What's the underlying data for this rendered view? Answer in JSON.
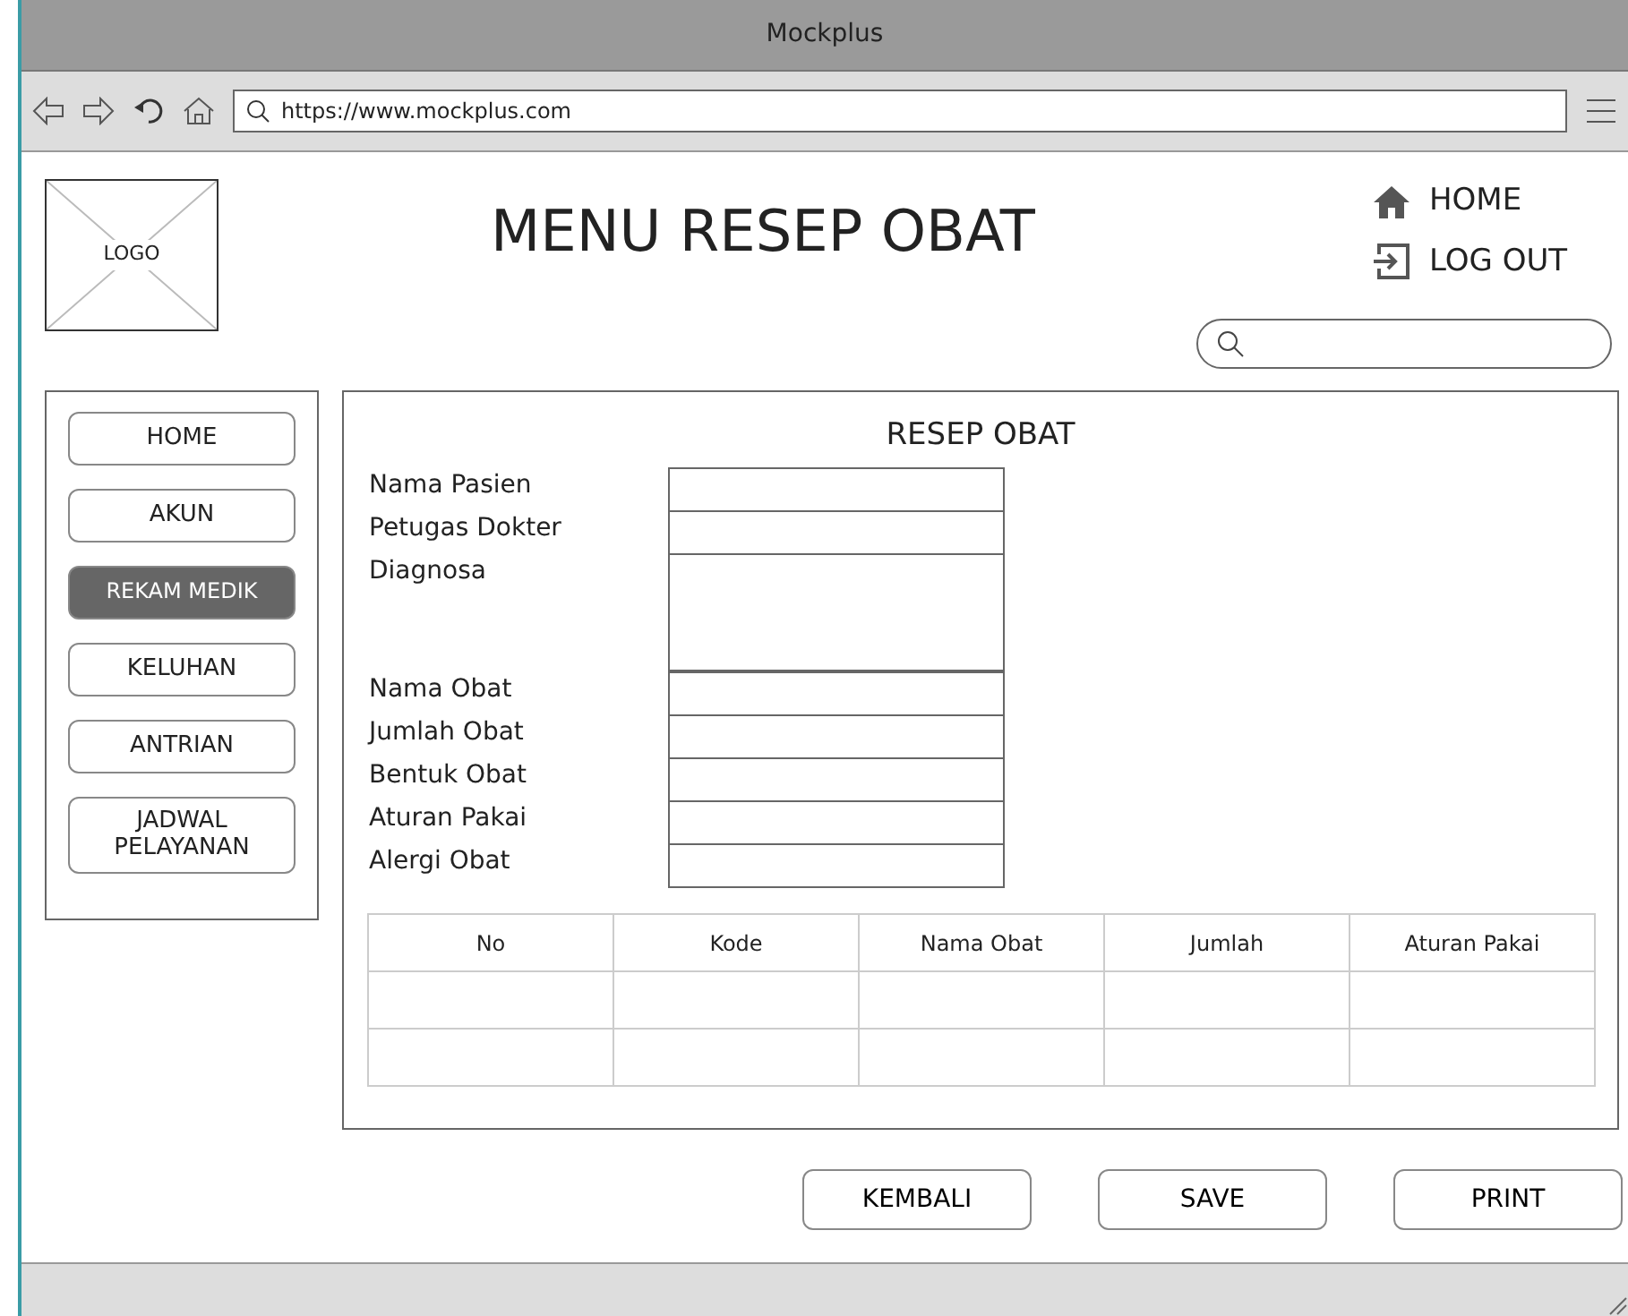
{
  "window": {
    "title": "Mockplus"
  },
  "address_bar": {
    "url": "https://www.mockplus.com"
  },
  "header": {
    "logo": "LOGO",
    "title": "MENU RESEP OBAT",
    "links": [
      {
        "kind": "home",
        "label": "HOME"
      },
      {
        "kind": "logout",
        "label": "LOG OUT"
      }
    ]
  },
  "sidebar": {
    "items": [
      {
        "label": "HOME",
        "selected": false
      },
      {
        "label": "AKUN",
        "selected": false
      },
      {
        "label": "REKAM MEDIK",
        "selected": true
      },
      {
        "label": "KELUHAN",
        "selected": false
      },
      {
        "label": "ANTRIAN",
        "selected": false
      },
      {
        "label": "JADWAL PELAYANAN",
        "selected": false
      }
    ]
  },
  "form": {
    "title": "RESEP OBAT",
    "fields": [
      {
        "label": "Nama Pasien",
        "kind": "text"
      },
      {
        "label": "Petugas Dokter",
        "kind": "text"
      },
      {
        "label": "Diagnosa",
        "kind": "textarea"
      },
      {
        "label": "Nama Obat",
        "kind": "text"
      },
      {
        "label": "Jumlah Obat",
        "kind": "text"
      },
      {
        "label": "Bentuk Obat",
        "kind": "text"
      },
      {
        "label": "Aturan Pakai",
        "kind": "text"
      },
      {
        "label": "Alergi Obat",
        "kind": "text"
      }
    ],
    "table": {
      "columns": [
        "No",
        "Kode",
        "Nama Obat",
        "Jumlah",
        "Aturan Pakai"
      ]
    }
  },
  "buttons": [
    "KEMBALI",
    "SAVE",
    "PRINT"
  ]
}
